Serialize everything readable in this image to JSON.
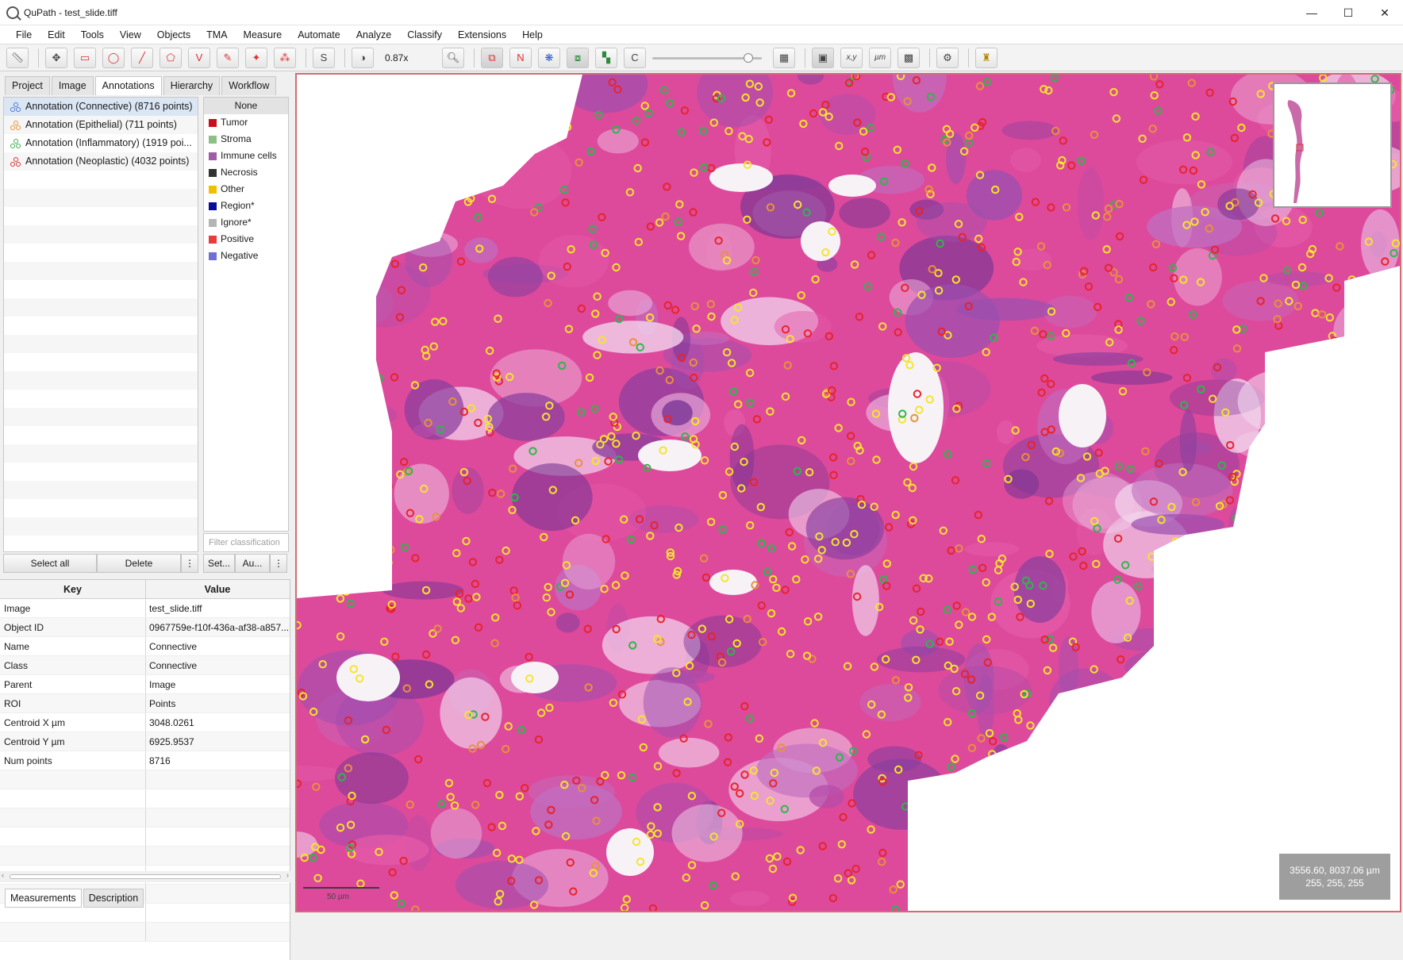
{
  "window": {
    "title": "QuPath - test_slide.tiff"
  },
  "menu": [
    "File",
    "Edit",
    "Tools",
    "View",
    "Objects",
    "TMA",
    "Measure",
    "Automate",
    "Analyze",
    "Classify",
    "Extensions",
    "Help"
  ],
  "toolbar": {
    "tools": [
      {
        "name": "move-tool",
        "glyph": "✥"
      },
      {
        "name": "rectangle-tool",
        "glyph": "▭"
      },
      {
        "name": "ellipse-tool",
        "glyph": "◯"
      },
      {
        "name": "line-tool",
        "glyph": "╱"
      },
      {
        "name": "polygon-tool",
        "glyph": "⬠"
      },
      {
        "name": "polyline-tool",
        "glyph": "V"
      },
      {
        "name": "brush-tool",
        "glyph": "✎"
      },
      {
        "name": "wand-tool",
        "glyph": "✦"
      },
      {
        "name": "points-tool",
        "glyph": "⁂"
      }
    ],
    "zoom": "0.87x",
    "brightness_slider_level": 0.88
  },
  "left_tabs": [
    "Project",
    "Image",
    "Annotations",
    "Hierarchy",
    "Workflow"
  ],
  "left_active_tab": "Annotations",
  "annotations": [
    {
      "label": "Annotation (Connective) (8716 points)",
      "color": "#4c78d8"
    },
    {
      "label": "Annotation (Epithelial) (711 points)",
      "color": "#e8923a"
    },
    {
      "label": "Annotation (Inflammatory) (1919 poi...",
      "color": "#3fae4e"
    },
    {
      "label": "Annotation (Neoplastic) (4032 points)",
      "color": "#d8332f"
    }
  ],
  "classes": {
    "none_label": "None",
    "items": [
      {
        "label": "Tumor",
        "color": "#c8101c"
      },
      {
        "label": "Stroma",
        "color": "#8fbf88"
      },
      {
        "label": "Immune cells",
        "color": "#a05aa8"
      },
      {
        "label": "Necrosis",
        "color": "#323232"
      },
      {
        "label": "Other",
        "color": "#f0c000"
      },
      {
        "label": "Region*",
        "color": "#0a0aa0"
      },
      {
        "label": "Ignore*",
        "color": "#b4b4b4"
      },
      {
        "label": "Positive",
        "color": "#e63c3c"
      },
      {
        "label": "Negative",
        "color": "#7070d8"
      }
    ],
    "filter_placeholder": "Filter classification"
  },
  "buttons": {
    "select_all": "Select all",
    "delete": "Delete",
    "more": "⋮",
    "set": "Set...",
    "auto": "Au..."
  },
  "properties": {
    "key_header": "Key",
    "value_header": "Value",
    "rows": [
      {
        "key": "Image",
        "value": "test_slide.tiff"
      },
      {
        "key": "Object ID",
        "value": "0967759e-f10f-436a-af38-a857..."
      },
      {
        "key": "Name",
        "value": "Connective"
      },
      {
        "key": "Class",
        "value": "Connective"
      },
      {
        "key": "Parent",
        "value": "Image"
      },
      {
        "key": "ROI",
        "value": "Points"
      },
      {
        "key": "Centroid X µm",
        "value": "3048.0261"
      },
      {
        "key": "Centroid Y µm",
        "value": "6925.9537"
      },
      {
        "key": "Num points",
        "value": "8716"
      }
    ]
  },
  "bottom_tabs": [
    "Measurements",
    "Description"
  ],
  "viewer": {
    "cursor_position": "3556.60, 8037.06 µm",
    "pixel_value": "255, 255, 255",
    "scale_label": "50 µm"
  }
}
